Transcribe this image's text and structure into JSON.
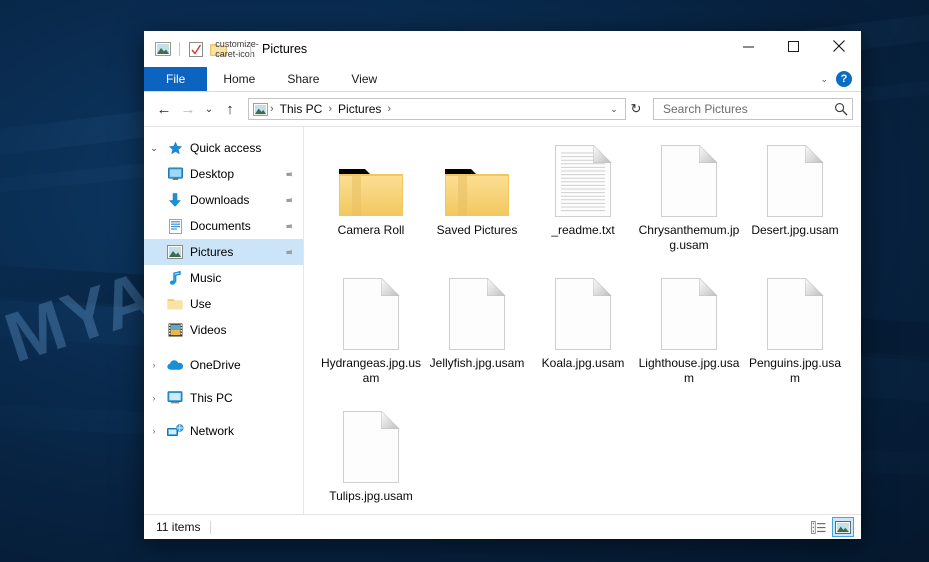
{
  "desktop": {
    "watermark": "MYANTISPYWARE.COM"
  },
  "window": {
    "title": "Pictures",
    "quick_access_icons": [
      "pictures-folder-icon",
      "properties-icon",
      "new-folder-icon",
      "customize-caret-icon"
    ],
    "controls": {
      "minimize": "—",
      "maximize": "☐",
      "close": "✕"
    }
  },
  "ribbon": {
    "tabs": [
      {
        "label": "File",
        "active": true
      },
      {
        "label": "Home",
        "active": false
      },
      {
        "label": "Share",
        "active": false
      },
      {
        "label": "View",
        "active": false
      }
    ],
    "expand_caret": "⌄",
    "help_label": "?"
  },
  "address": {
    "back": "←",
    "forward": "→",
    "recent_caret": "⌄",
    "up": "↑",
    "breadcrumbs": [
      "This PC",
      "Pictures"
    ],
    "separator": "›",
    "dropdown_caret": "⌄",
    "refresh": "↻",
    "search": {
      "placeholder": "Search Pictures",
      "value": "",
      "icon": "search-icon"
    }
  },
  "sidebar": {
    "items": [
      {
        "label": "Quick access",
        "icon": "star-icon",
        "level": 1,
        "chevron": "open",
        "pinned": false,
        "selected": false
      },
      {
        "label": "Desktop",
        "icon": "desktop-icon",
        "level": 2,
        "chevron": "none",
        "pinned": true,
        "selected": false
      },
      {
        "label": "Downloads",
        "icon": "download-icon",
        "level": 2,
        "chevron": "none",
        "pinned": true,
        "selected": false
      },
      {
        "label": "Documents",
        "icon": "document-icon",
        "level": 2,
        "chevron": "none",
        "pinned": true,
        "selected": false
      },
      {
        "label": "Pictures",
        "icon": "pictures-icon",
        "level": 2,
        "chevron": "none",
        "pinned": true,
        "selected": true
      },
      {
        "label": "Music",
        "icon": "music-icon",
        "level": 2,
        "chevron": "none",
        "pinned": false,
        "selected": false
      },
      {
        "label": "Use",
        "icon": "folder-icon",
        "level": 2,
        "chevron": "none",
        "pinned": false,
        "selected": false
      },
      {
        "label": "Videos",
        "icon": "video-icon",
        "level": 2,
        "chevron": "none",
        "pinned": false,
        "selected": false
      },
      {
        "label": "OneDrive",
        "icon": "cloud-icon",
        "level": 1,
        "chevron": "closed",
        "pinned": false,
        "selected": false
      },
      {
        "label": "This PC",
        "icon": "thispc-icon",
        "level": 1,
        "chevron": "closed",
        "pinned": false,
        "selected": false
      },
      {
        "label": "Network",
        "icon": "network-icon",
        "level": 1,
        "chevron": "closed",
        "pinned": false,
        "selected": false
      }
    ],
    "chevron_open": "⌄",
    "chevron_closed": "›",
    "pin_glyph": "📌"
  },
  "files": [
    {
      "name": "Camera Roll",
      "type": "folder"
    },
    {
      "name": "Saved Pictures",
      "type": "folder"
    },
    {
      "name": "_readme.txt",
      "type": "text"
    },
    {
      "name": "Chrysanthemum.jpg.usam",
      "type": "file"
    },
    {
      "name": "Desert.jpg.usam",
      "type": "file"
    },
    {
      "name": "Hydrangeas.jpg.usam",
      "type": "file"
    },
    {
      "name": "Jellyfish.jpg.usam",
      "type": "file"
    },
    {
      "name": "Koala.jpg.usam",
      "type": "file"
    },
    {
      "name": "Lighthouse.jpg.usam",
      "type": "file"
    },
    {
      "name": "Penguins.jpg.usam",
      "type": "file"
    },
    {
      "name": "Tulips.jpg.usam",
      "type": "file"
    }
  ],
  "statusbar": {
    "item_count": "11 items",
    "views": [
      {
        "name": "details-view-button",
        "active": false
      },
      {
        "name": "large-icons-view-button",
        "active": true
      }
    ]
  },
  "colors": {
    "accent": "#0c64c0",
    "selection": "#cce4f7",
    "folder": "#f6cf6b",
    "desktop": "#0a2d52"
  }
}
